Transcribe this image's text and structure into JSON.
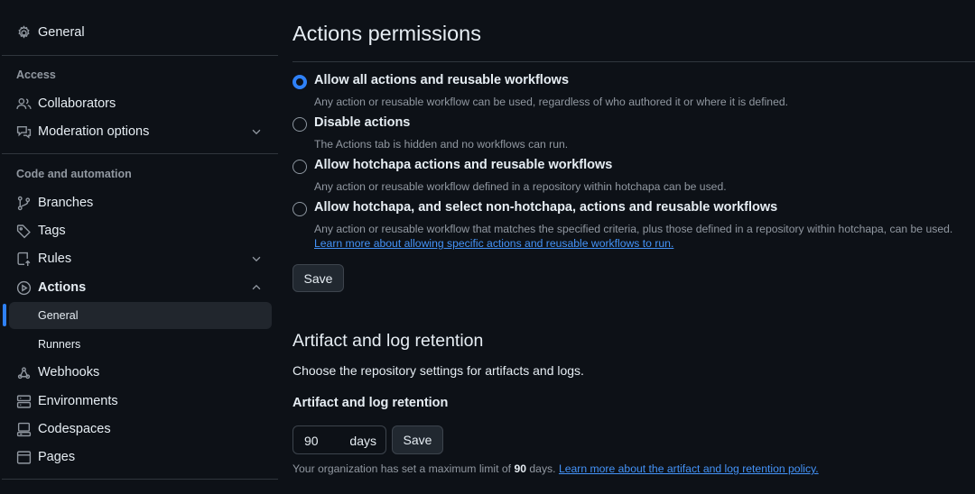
{
  "sidebar": {
    "general": "General",
    "access_heading": "Access",
    "collaborators": "Collaborators",
    "moderation": "Moderation options",
    "code_heading": "Code and automation",
    "branches": "Branches",
    "tags": "Tags",
    "rules": "Rules",
    "actions": "Actions",
    "actions_general": "General",
    "actions_runners": "Runners",
    "webhooks": "Webhooks",
    "environments": "Environments",
    "codespaces": "Codespaces",
    "pages": "Pages"
  },
  "permissions": {
    "title": "Actions permissions",
    "options": [
      {
        "label": "Allow all actions and reusable workflows",
        "desc": "Any action or reusable workflow can be used, regardless of who authored it or where it is defined.",
        "checked": true
      },
      {
        "label": "Disable actions",
        "desc": "The Actions tab is hidden and no workflows can run.",
        "checked": false
      },
      {
        "label": "Allow hotchapa actions and reusable workflows",
        "desc": "Any action or reusable workflow defined in a repository within hotchapa can be used.",
        "checked": false
      },
      {
        "label": "Allow hotchapa, and select non-hotchapa, actions and reusable workflows",
        "desc": "Any action or reusable workflow that matches the specified criteria, plus those defined in a repository within hotchapa, can be used.",
        "checked": false
      }
    ],
    "learn_more": "Learn more about allowing specific actions and reusable workflows to run.",
    "save": "Save"
  },
  "retention": {
    "title": "Artifact and log retention",
    "description": "Choose the repository settings for artifacts and logs.",
    "field_label": "Artifact and log retention",
    "days_value": "90",
    "days_suffix": "days",
    "save": "Save",
    "note_prefix": "Your organization has set a maximum limit of",
    "note_value": "90",
    "note_suffix": "days.",
    "note_link": "Learn more about the artifact and log retention policy."
  },
  "colors": {
    "accent": "#2f81f7",
    "link": "#4493f8",
    "background": "#0d1117"
  }
}
